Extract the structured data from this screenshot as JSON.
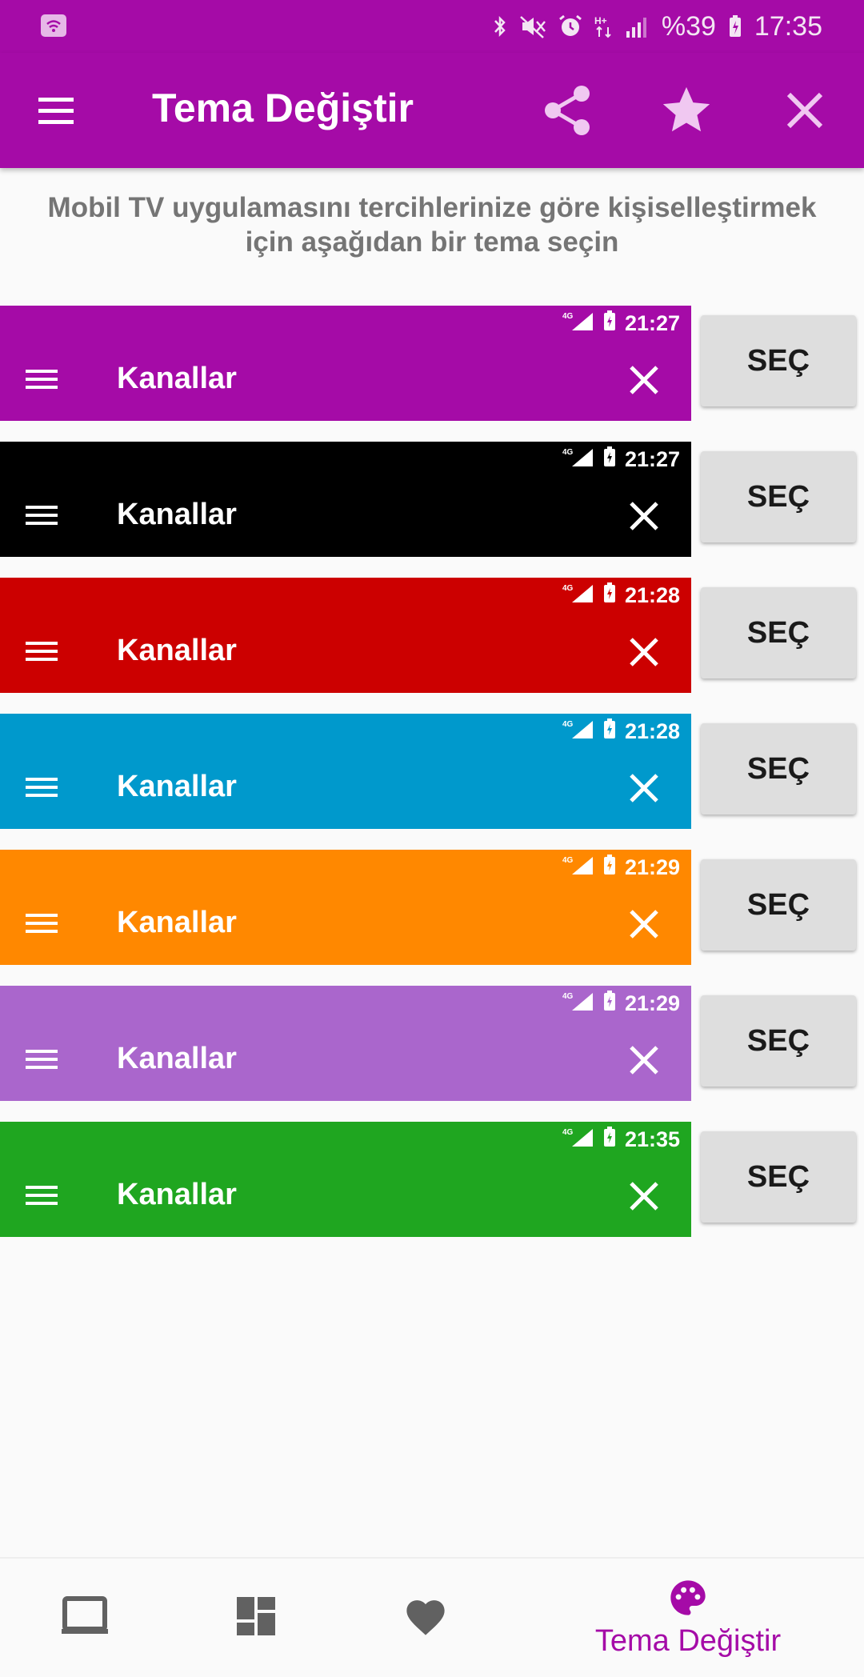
{
  "status_bar": {
    "battery": "%39",
    "time": "17:35",
    "icons": [
      "wifi-icon",
      "bluetooth-icon",
      "mute-icon",
      "alarm-icon",
      "data-icon",
      "signal-icon",
      "battery-icon"
    ]
  },
  "app_bar": {
    "title": "Tema Değiştir",
    "icons": [
      "menu-icon",
      "share-icon",
      "star-icon",
      "close-icon"
    ]
  },
  "intro_text": "Mobil TV uygulamasını tercihlerinize göre kişiselleştirmek için aşağıdan bir tema seçin",
  "themes": [
    {
      "color": "#a50ba7",
      "time": "21:27",
      "title": "Kanallar",
      "button": "SEÇ"
    },
    {
      "color": "#000000",
      "time": "21:27",
      "title": "Kanallar",
      "button": "SEÇ"
    },
    {
      "color": "#cc0000",
      "time": "21:28",
      "title": "Kanallar",
      "button": "SEÇ"
    },
    {
      "color": "#0099cc",
      "time": "21:28",
      "title": "Kanallar",
      "button": "SEÇ"
    },
    {
      "color": "#ff8800",
      "time": "21:29",
      "title": "Kanallar",
      "button": "SEÇ"
    },
    {
      "color": "#aa66cc",
      "time": "21:29",
      "title": "Kanallar",
      "button": "SEÇ"
    },
    {
      "color": "#1fa620",
      "time": "21:35",
      "title": "Kanallar",
      "button": "SEÇ"
    }
  ],
  "bottom_nav": {
    "items": [
      {
        "icon": "tv-icon",
        "label": ""
      },
      {
        "icon": "dashboard-icon",
        "label": ""
      },
      {
        "icon": "heart-icon",
        "label": ""
      },
      {
        "icon": "palette-icon",
        "label": "Tema Değiştir",
        "active": true
      }
    ],
    "active_color": "#a50ba7",
    "inactive_color": "#616161"
  }
}
